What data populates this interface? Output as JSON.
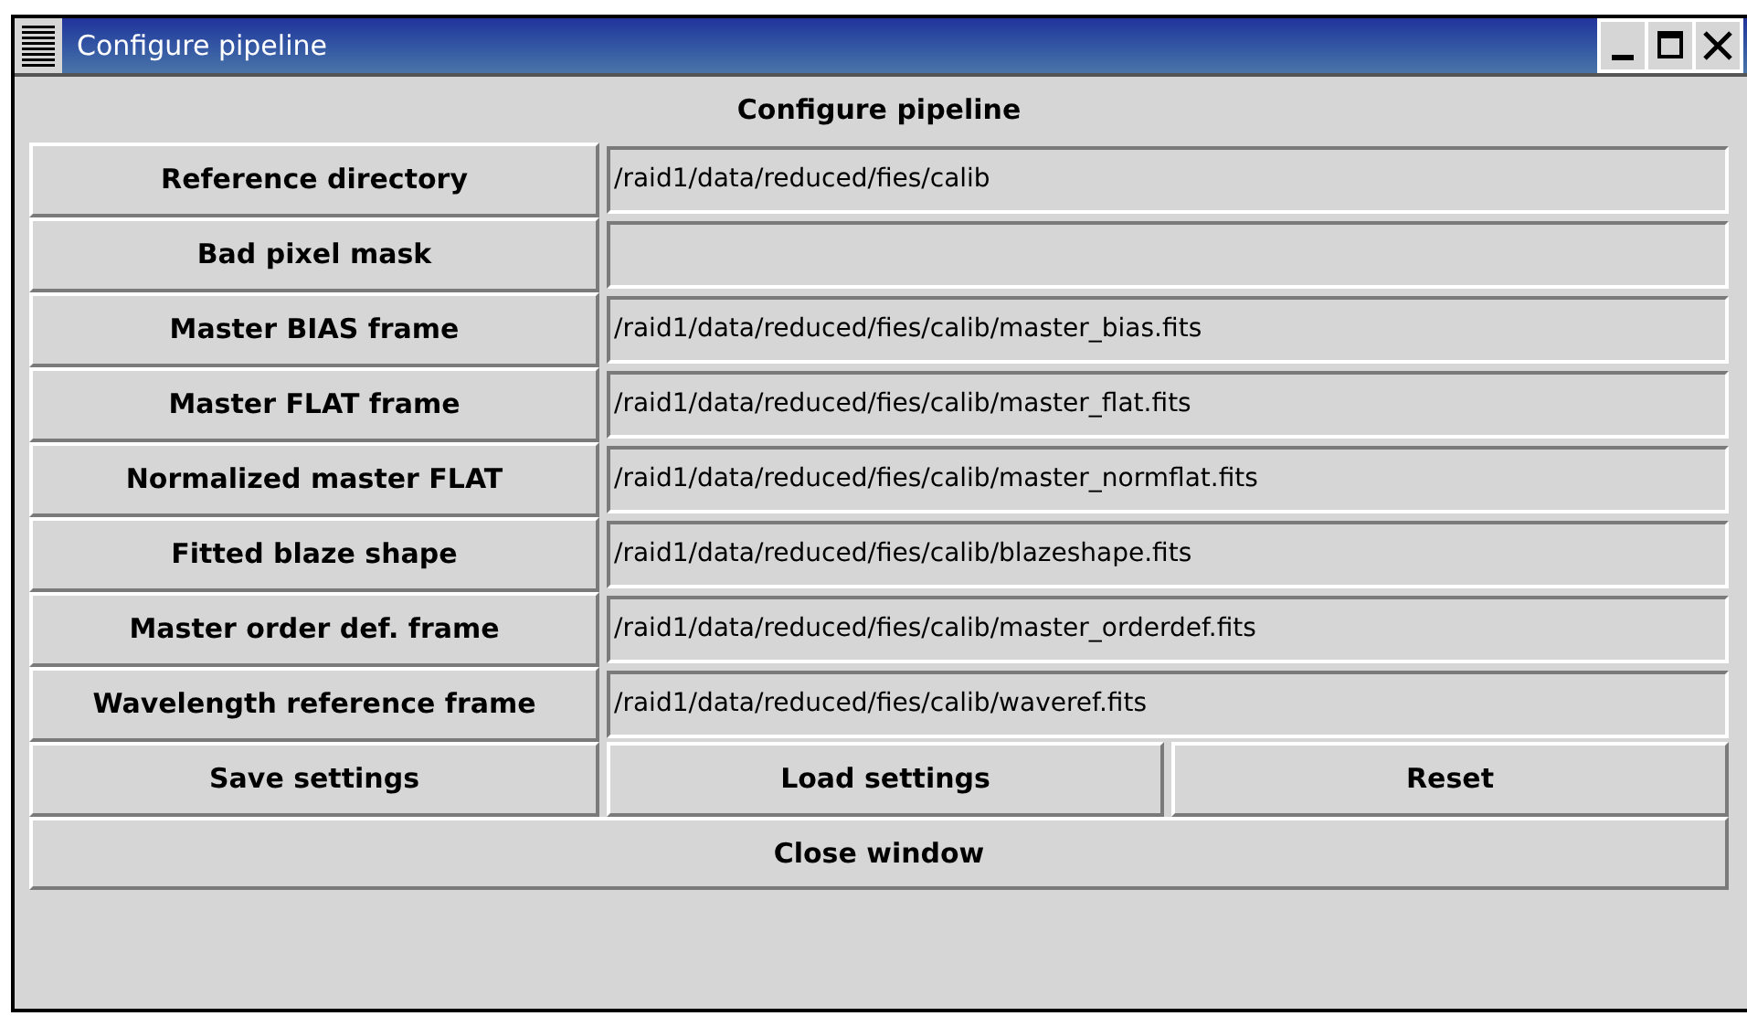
{
  "window": {
    "title": "Configure pipeline"
  },
  "heading": "Configure pipeline",
  "rows": [
    {
      "label": "Reference directory",
      "value": "/raid1/data/reduced/fies/calib"
    },
    {
      "label": "Bad pixel mask",
      "value": ""
    },
    {
      "label": "Master BIAS frame",
      "value": "/raid1/data/reduced/fies/calib/master_bias.fits"
    },
    {
      "label": "Master FLAT frame",
      "value": "/raid1/data/reduced/fies/calib/master_flat.fits"
    },
    {
      "label": "Normalized master FLAT",
      "value": "/raid1/data/reduced/fies/calib/master_normflat.fits"
    },
    {
      "label": "Fitted blaze shape",
      "value": "/raid1/data/reduced/fies/calib/blazeshape.fits"
    },
    {
      "label": "Master order def. frame",
      "value": "/raid1/data/reduced/fies/calib/master_orderdef.fits"
    },
    {
      "label": "Wavelength reference frame",
      "value": "/raid1/data/reduced/fies/calib/waveref.fits"
    }
  ],
  "buttons": [
    "Save settings",
    "Load settings",
    "Reset"
  ],
  "close_button": "Close window"
}
